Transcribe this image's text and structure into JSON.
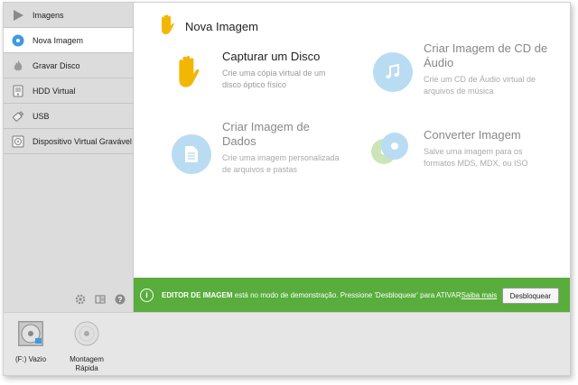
{
  "sidebar": {
    "items": [
      {
        "label": "Imagens",
        "icon": "play-icon"
      },
      {
        "label": "Nova Imagem",
        "icon": "disc-blue-icon"
      },
      {
        "label": "Gravar Disco",
        "icon": "flame-icon"
      },
      {
        "label": "HDD Virtual",
        "icon": "hdd-icon"
      },
      {
        "label": "USB",
        "icon": "usb-icon"
      },
      {
        "label": "Dispositivo Virtual Gravável",
        "icon": "writable-device-icon"
      }
    ],
    "active_index": 1
  },
  "main": {
    "title": "Nova Imagem",
    "cards": [
      {
        "name": "Capturar um Disco",
        "desc": "Crie uma cópia virtual de um disco óptico físico",
        "icon": "hand-icon"
      },
      {
        "name": "Criar Imagem de CD de Áudio",
        "desc": "Crie um CD de Áudio virtual de arquivos de música",
        "icon": "music-note-icon"
      },
      {
        "name": "Criar Imagem de Dados",
        "desc": "Crie uma imagem personalizada de arquivos e pastas",
        "icon": "document-icon"
      },
      {
        "name": "Converter Imagem",
        "desc": "Salve uma imagem para os formatos MDS, MDX, ou ISO",
        "icon": "convert-discs-icon"
      }
    ]
  },
  "banner": {
    "info_glyph": "i",
    "strong": "EDITOR DE IMAGEM",
    "message": " está no modo de demonstração. Pressione 'Desbloquear' para ATIVAR",
    "link": "Saiba mais",
    "button": "Desbloquear"
  },
  "drives": [
    {
      "label": "(F:) Vazio",
      "icon": "virtual-drive-icon"
    },
    {
      "label": "Montagem Rápida",
      "icon": "quick-mount-icon"
    }
  ],
  "colors": {
    "accent_green": "#58ad3c",
    "icon_blue": "#b9dcf2",
    "hand_yellow": "#f2b705"
  }
}
